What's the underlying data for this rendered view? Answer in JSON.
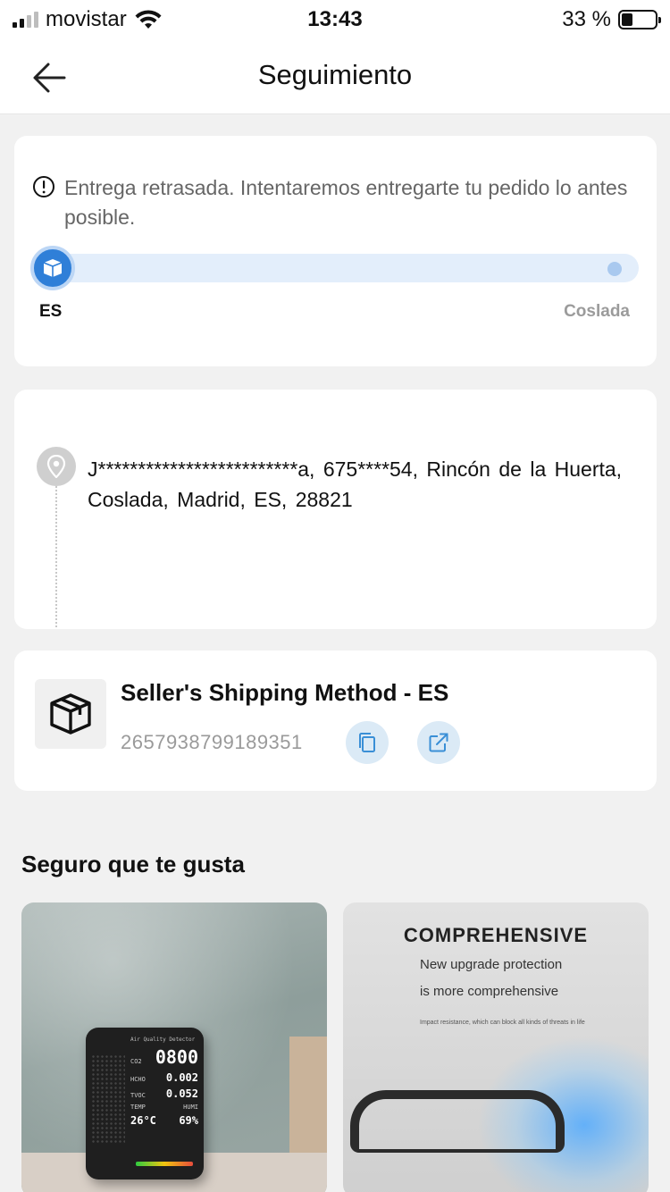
{
  "status_bar": {
    "carrier": "movistar",
    "time": "13:43",
    "battery": "33 %",
    "battery_level": 0.33
  },
  "header": {
    "title": "Seguimiento",
    "back_icon": "arrow-left-icon"
  },
  "tracking": {
    "alert_icon": "exclamation-circle-icon",
    "alert_text": "Entrega retrasada. Intentaremos entregarte tu pedido lo antes posible.",
    "origin": "ES",
    "destination": "Coslada",
    "accent_color": "#2f7fd8"
  },
  "address": {
    "icon": "location-pin-icon",
    "text": "J*************************a, 675****54, Rincón de la Huerta, Coslada, Madrid, ES, 28821"
  },
  "shipping": {
    "icon": "package-box-icon",
    "method": "Seller's Shipping Method - ES",
    "tracking_number": "2657938799189351",
    "copy_icon": "copy-icon",
    "open_icon": "external-link-icon"
  },
  "recommendations": {
    "title": "Seguro que te gusta",
    "products": [
      {
        "image": "air-quality-detector-photo",
        "device_title": "Air Quality Detector",
        "device_rows": [
          {
            "label": "CO2",
            "value": "0800"
          },
          {
            "label": "HCHO",
            "value": "0.002"
          },
          {
            "label": "TVOC",
            "value": "0.052"
          },
          {
            "label": "TEMP",
            "value": "26°C"
          },
          {
            "label": "HUMI",
            "value": "69%"
          }
        ]
      },
      {
        "image": "protective-visor-ad",
        "headline": "COMPREHENSIVE",
        "line1": "New upgrade protection",
        "line2": "is more comprehensive",
        "small": "Impact resistance, which can block all kinds of threats in life"
      }
    ]
  }
}
